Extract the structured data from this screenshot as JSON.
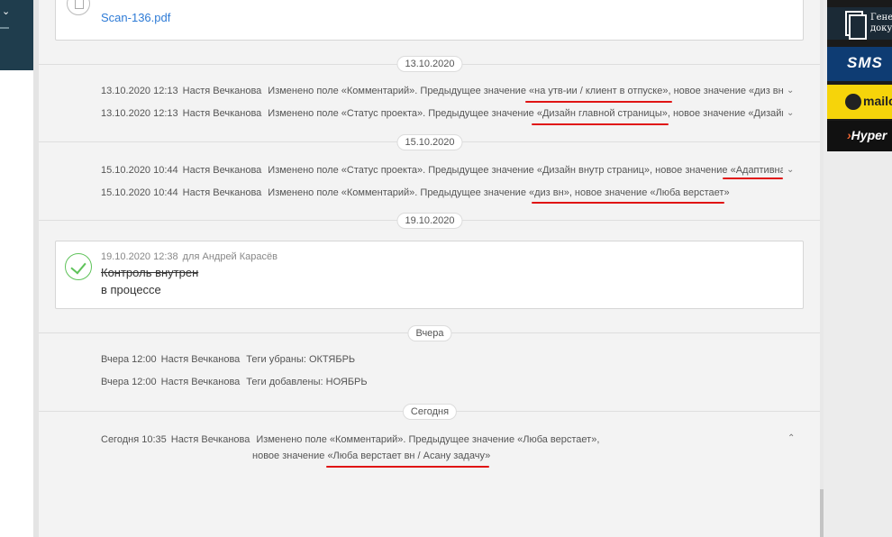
{
  "file": {
    "name": "Scan-136.pdf"
  },
  "banners": {
    "b1": "Гене\nдоку",
    "sms": "SMS",
    "mail": "mailo",
    "hyper": "Hyper"
  },
  "groups": {
    "g1": {
      "date": "13.10.2020",
      "rows": [
        {
          "time": "13.10.2020 12:13",
          "author": "Настя Вечканова",
          "text": "Изменено поле «Комментарий». Предыдущее значение «на утв-ии / клиент в отпуске», новое значение «диз вн»"
        },
        {
          "time": "13.10.2020 12:13",
          "author": "Настя Вечканова",
          "text": "Изменено поле «Статус проекта». Предыдущее значение «Дизайн главной страницы», новое значение «Дизайн вн"
        }
      ]
    },
    "g2": {
      "date": "15.10.2020",
      "rows": [
        {
          "time": "15.10.2020 10:44",
          "author": "Настя Вечканова",
          "text": "Изменено поле «Статус проекта». Предыдущее значение «Дизайн внутр страниц», новое значение «Адаптивная"
        },
        {
          "time": "15.10.2020 10:44",
          "author": "Настя Вечканова",
          "text": "Изменено поле «Комментарий». Предыдущее значение «диз вн», новое значение «Люба верстает»"
        }
      ]
    },
    "g3": {
      "date": "19.10.2020",
      "task": {
        "time": "19.10.2020 12:38",
        "for": "для Андрей Карасёв",
        "title": "Контроль внутрен",
        "status": "в процессе"
      }
    },
    "g4": {
      "date": "Вчера",
      "rows": [
        {
          "time": "Вчера 12:00",
          "author": "Настя Вечканова",
          "text": "Теги убраны: ОКТЯБРЬ"
        },
        {
          "time": "Вчера 12:00",
          "author": "Настя Вечканова",
          "text": "Теги добавлены: НОЯБРЬ"
        }
      ]
    },
    "g5": {
      "date": "Сегодня",
      "row": {
        "time": "Сегодня 10:35",
        "author": "Настя Вечканова",
        "line1": "Изменено поле «Комментарий». Предыдущее значение «Люба верстает»,",
        "line2": "новое значение «Люба верстает вн / Асану задачу»"
      }
    }
  },
  "colors": {
    "accent_red": "#e01414",
    "link": "#2e7bd6",
    "check": "#5fc35a"
  }
}
